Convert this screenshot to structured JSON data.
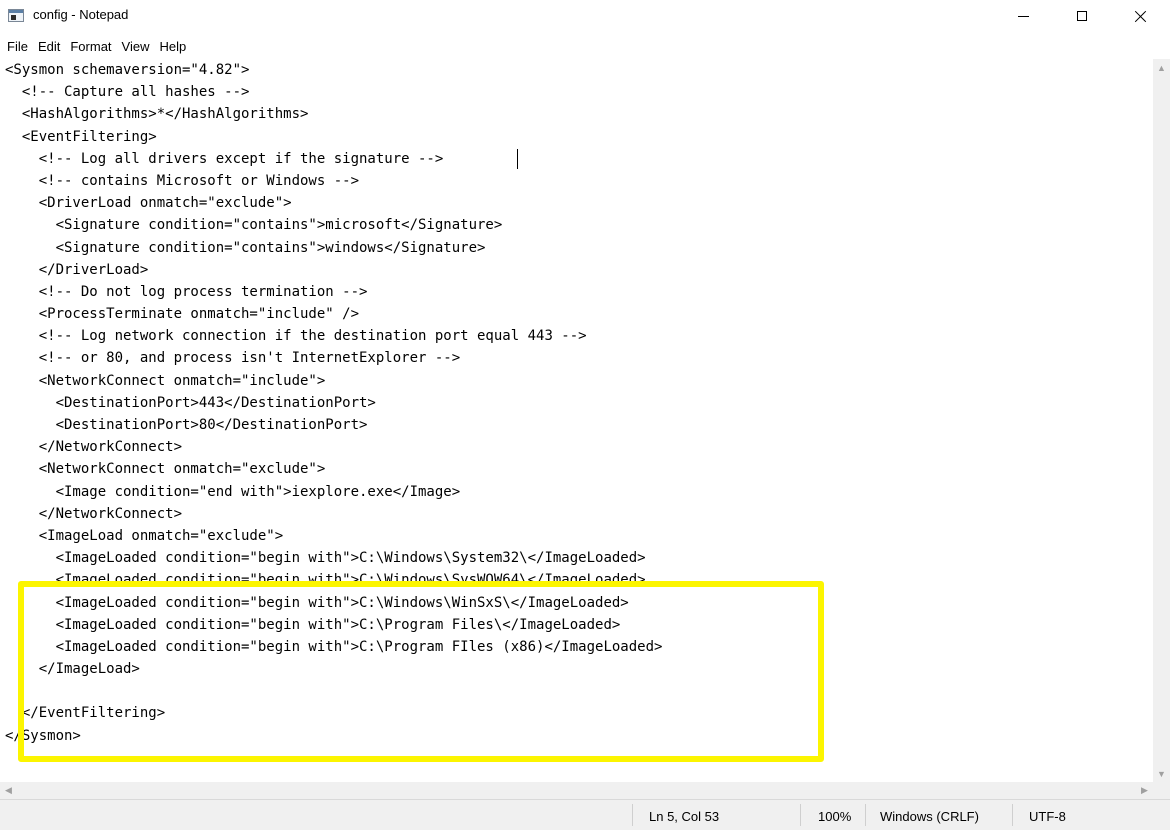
{
  "window": {
    "title": "config - Notepad",
    "icon": "notepad-icon",
    "controls": {
      "minimize": "minimize-icon",
      "maximize": "maximize-icon",
      "close": "close-icon"
    }
  },
  "menu": [
    "File",
    "Edit",
    "Format",
    "View",
    "Help"
  ],
  "editor": {
    "lines": [
      "<Sysmon schemaversion=\"4.82\">",
      "  <!-- Capture all hashes -->",
      "  <HashAlgorithms>*</HashAlgorithms>",
      "  <EventFiltering>",
      "    <!-- Log all drivers except if the signature -->",
      "    <!-- contains Microsoft or Windows -->",
      "    <DriverLoad onmatch=\"exclude\">",
      "      <Signature condition=\"contains\">microsoft</Signature>",
      "      <Signature condition=\"contains\">windows</Signature>",
      "    </DriverLoad>",
      "    <!-- Do not log process termination -->",
      "    <ProcessTerminate onmatch=\"include\" />",
      "    <!-- Log network connection if the destination port equal 443 -->",
      "    <!-- or 80, and process isn't InternetExplorer -->",
      "    <NetworkConnect onmatch=\"include\">",
      "      <DestinationPort>443</DestinationPort>",
      "      <DestinationPort>80</DestinationPort>",
      "    </NetworkConnect>",
      "    <NetworkConnect onmatch=\"exclude\">",
      "      <Image condition=\"end with\">iexplore.exe</Image>",
      "    </NetworkConnect>",
      "    <ImageLoad onmatch=\"exclude\">",
      "      <ImageLoaded condition=\"begin with\">C:\\Windows\\System32\\</ImageLoaded>",
      "      <ImageLoaded condition=\"begin with\">C:\\Windows\\SysWOW64\\</ImageLoaded>",
      "      <ImageLoaded condition=\"begin with\">C:\\Windows\\WinSxS\\</ImageLoaded>",
      "      <ImageLoaded condition=\"begin with\">C:\\Program Files\\</ImageLoaded>",
      "      <ImageLoaded condition=\"begin with\">C:\\Program FIles (x86)</ImageLoaded>",
      "    </ImageLoad>",
      "",
      "  </EventFiltering>",
      "</Sysmon>"
    ],
    "highlight_color": "#fcf500"
  },
  "status": {
    "position": "Ln 5, Col 53",
    "zoom": "100%",
    "line_ending": "Windows (CRLF)",
    "encoding": "UTF-8"
  }
}
